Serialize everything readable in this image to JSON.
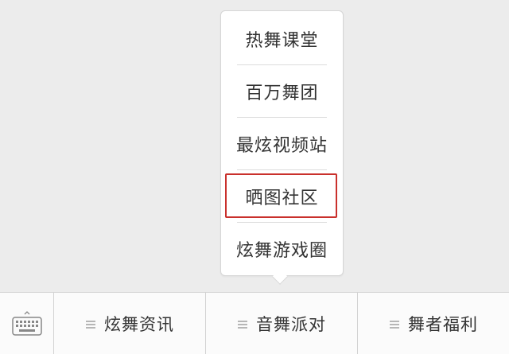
{
  "submenu": {
    "items": [
      {
        "label": "热舞课堂"
      },
      {
        "label": "百万舞团"
      },
      {
        "label": "最炫视频站"
      },
      {
        "label": "晒图社区",
        "highlighted": true
      },
      {
        "label": "炫舞游戏圈"
      }
    ]
  },
  "menubar": {
    "keyboard_icon": "keyboard-icon",
    "tabs": [
      {
        "label": "炫舞资讯",
        "icon": "menu-lines-icon"
      },
      {
        "label": "音舞派对",
        "icon": "menu-lines-icon"
      },
      {
        "label": "舞者福利",
        "icon": "menu-lines-icon"
      }
    ]
  },
  "colors": {
    "background": "#ececec",
    "highlight_border": "#c9302c",
    "text": "#333333"
  }
}
